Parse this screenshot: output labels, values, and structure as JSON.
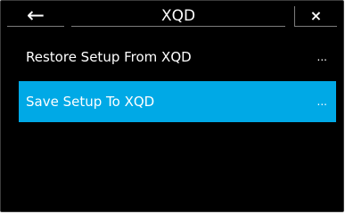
{
  "header": {
    "back_icon": "←",
    "title": "XQD",
    "close_icon": "×"
  },
  "menu": {
    "items": [
      {
        "label": "Restore Setup From XQD",
        "more": "...",
        "selected": false
      },
      {
        "label": "Save Setup To XQD",
        "more": "...",
        "selected": true
      }
    ]
  },
  "colors": {
    "background": "#000000",
    "selected": "#00a9e6",
    "text": "#ffffff",
    "divider": "#7c7c7c"
  }
}
